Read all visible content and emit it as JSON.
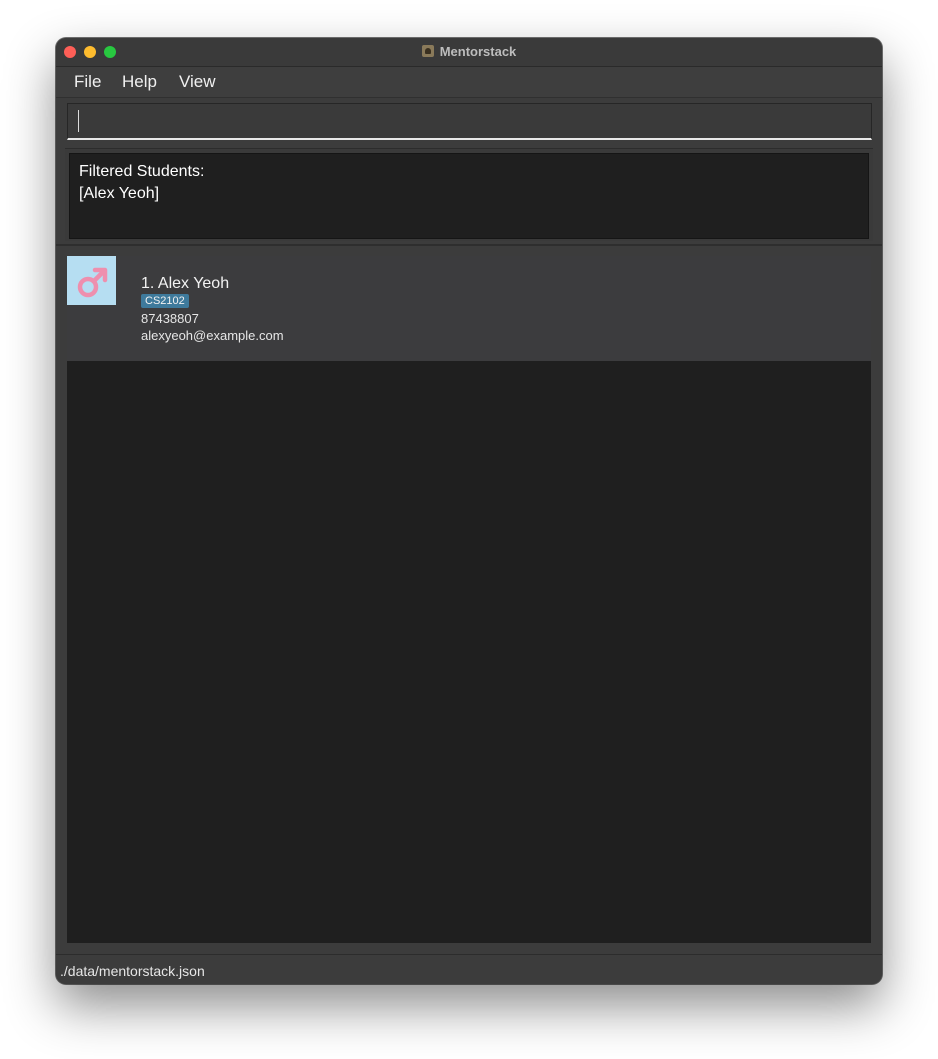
{
  "window": {
    "title": "Mentorstack"
  },
  "menu": {
    "file": "File",
    "help": "Help",
    "view": "View"
  },
  "command": {
    "value": ""
  },
  "result": {
    "line1": "Filtered Students:",
    "line2": "[Alex Yeoh]"
  },
  "students": [
    {
      "index": "1.",
      "name": "Alex Yeoh",
      "display": "1.  Alex Yeoh",
      "tag": "CS2102",
      "phone": "87438807",
      "email": "alexyeoh@example.com",
      "icon": "male-gender-icon"
    }
  ],
  "status": {
    "path": "./data/mentorstack.json"
  },
  "colors": {
    "avatar_bg": "#b6def2",
    "gender_symbol": "#ee8fae",
    "tag_bg": "#3e7a9c",
    "panel_bg": "#1f1f1f",
    "card_bg": "#3c3c3e"
  }
}
